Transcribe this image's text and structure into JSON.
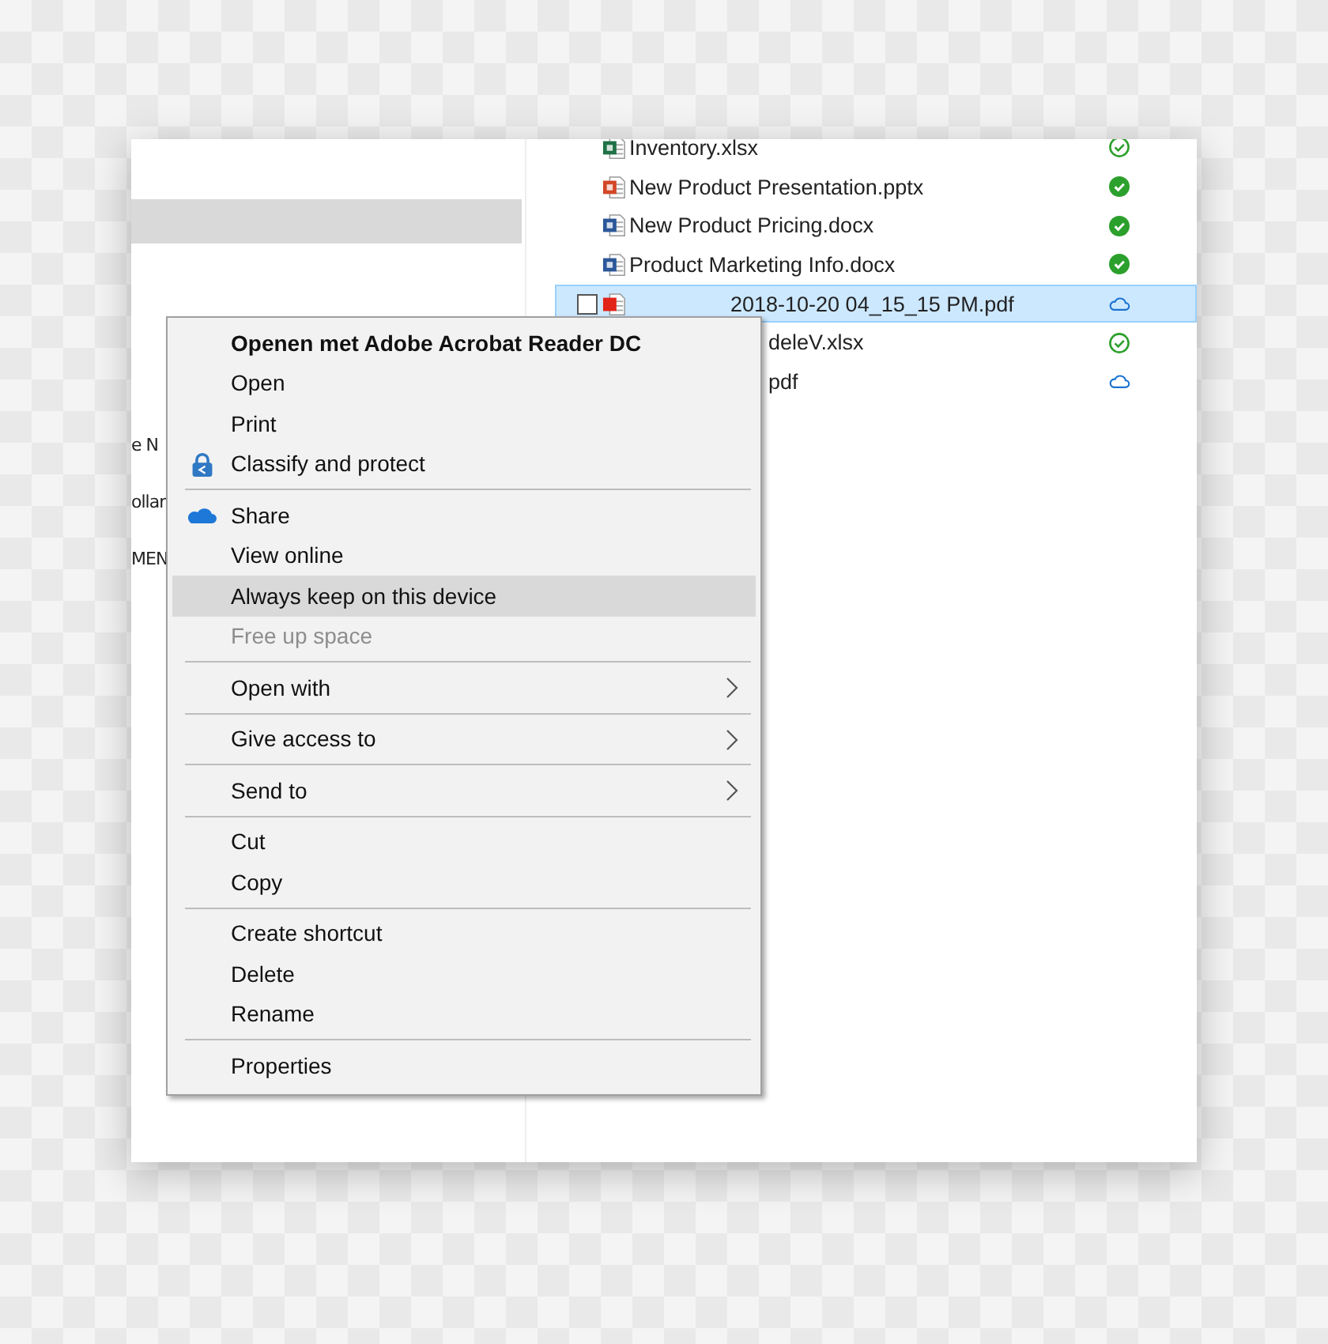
{
  "navigation_pane": {
    "items": [
      {
        "label": "e N"
      },
      {
        "label": "ollar"
      },
      {
        "label": "MEN"
      }
    ]
  },
  "files": [
    {
      "name": "Inventory.xlsx",
      "kind": "excel",
      "downloaded": true,
      "pinned": false,
      "selected": false,
      "obscured": false
    },
    {
      "name": "New Product Presentation.pptx",
      "kind": "powerpoint",
      "downloaded": true,
      "pinned": true,
      "selected": false,
      "obscured": false
    },
    {
      "name": "New Product Pricing.docx",
      "kind": "word",
      "downloaded": true,
      "pinned": true,
      "selected": false,
      "obscured": false
    },
    {
      "name": "Product Marketing Info.docx",
      "kind": "word",
      "downloaded": true,
      "pinned": true,
      "selected": false,
      "obscured": false
    },
    {
      "name": "2018-10-20 04_15_15 PM.pdf",
      "kind": "pdf",
      "downloaded": false,
      "pinned": false,
      "selected": true,
      "obscured": true
    },
    {
      "name": "deleV.xlsx",
      "downloaded": true,
      "pinned": false,
      "selected": false,
      "obscured": true
    },
    {
      "name": "pdf",
      "downloaded": false,
      "pinned": false,
      "selected": false,
      "obscured": true
    }
  ],
  "context_menu": {
    "groups": [
      [
        {
          "label": "Openen met Adobe Acrobat Reader DC",
          "kind": "default",
          "disabled": false,
          "selected": false
        },
        {
          "label": "Open",
          "kind": "text",
          "disabled": false,
          "selected": false
        },
        {
          "label": "Print",
          "kind": "text",
          "disabled": false,
          "selected": false
        },
        {
          "label": "Classify and protect",
          "kind": "protect",
          "disabled": false,
          "selected": false
        }
      ],
      [
        {
          "label": "Share",
          "kind": "share",
          "disabled": false,
          "selected": false
        },
        {
          "label": "View online",
          "kind": "text",
          "disabled": false,
          "selected": false
        },
        {
          "label": "Always keep on this device",
          "kind": "text",
          "disabled": false,
          "selected": true
        },
        {
          "label": "Free up space",
          "kind": "text",
          "disabled": true,
          "selected": false
        }
      ],
      [
        {
          "label": "Open with",
          "kind": "submenu",
          "disabled": false,
          "selected": false
        }
      ],
      [
        {
          "label": "Give access to",
          "kind": "submenu",
          "disabled": false,
          "selected": false
        }
      ],
      [
        {
          "label": "Send to",
          "kind": "submenu",
          "disabled": false,
          "selected": false
        }
      ],
      [
        {
          "label": "Cut",
          "kind": "text",
          "disabled": false,
          "selected": false
        },
        {
          "label": "Copy",
          "kind": "text",
          "disabled": false,
          "selected": false
        }
      ],
      [
        {
          "label": "Create shortcut",
          "kind": "text",
          "disabled": false,
          "selected": false
        },
        {
          "label": "Delete",
          "kind": "text",
          "disabled": false,
          "selected": false
        },
        {
          "label": "Rename",
          "kind": "text",
          "disabled": false,
          "selected": false
        }
      ],
      [
        {
          "label": "Properties",
          "kind": "text",
          "disabled": false,
          "selected": false
        }
      ]
    ]
  }
}
